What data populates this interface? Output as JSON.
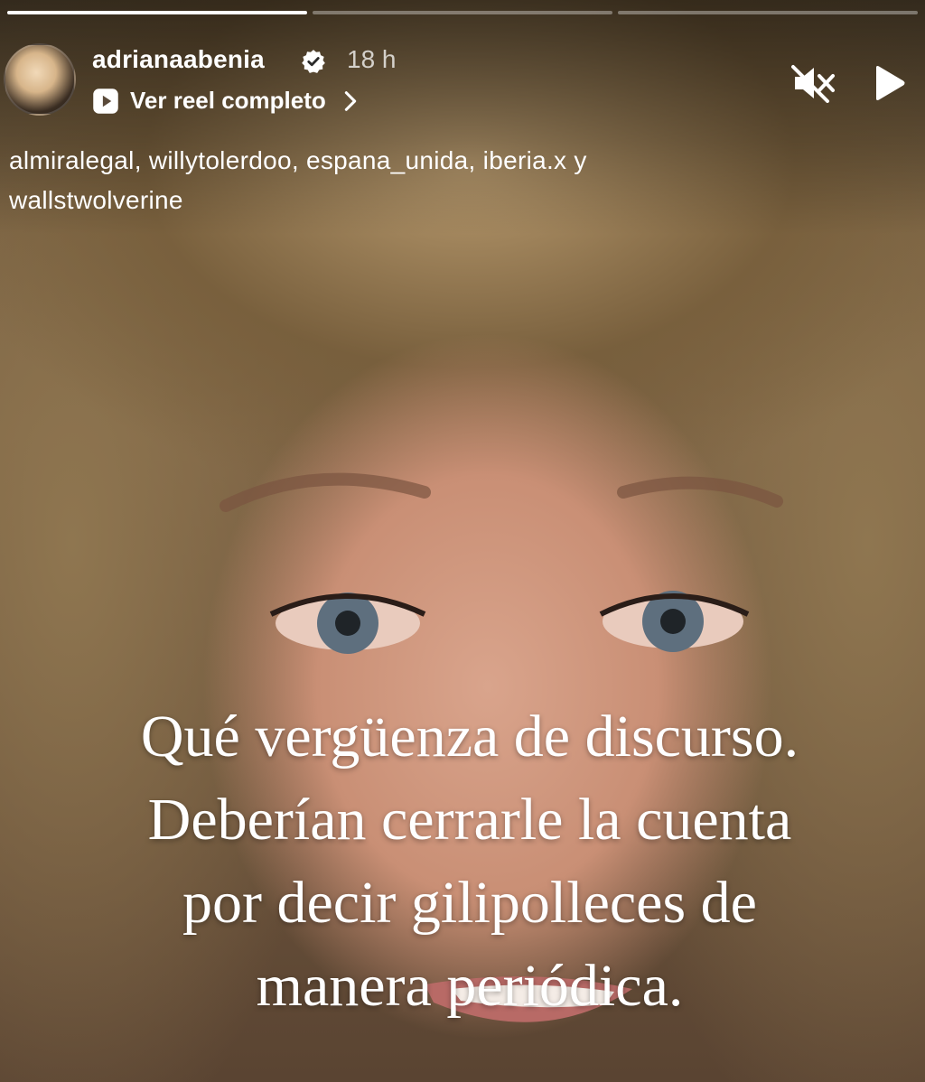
{
  "story": {
    "progress": [
      1,
      0,
      0
    ]
  },
  "header": {
    "username": "adrianaabenia",
    "time_ago": "18 h",
    "reel_link_label": "Ver reel completo"
  },
  "mentions": {
    "line1": "almiralegal, willytolerdoo, espana_unida, iberia.x y",
    "line2": "wallstwolverine"
  },
  "caption": {
    "line1": "Qué vergüenza de discurso.",
    "line2": "Deberían cerrarle la cuenta",
    "line3": "por decir gilipolleces de",
    "line4": "manera periódica."
  },
  "icons": {
    "verified": "verified-badge-icon",
    "reel": "reel-play-icon",
    "chevron": "chevron-right-icon",
    "mute": "muted-speaker-icon",
    "play": "play-icon"
  },
  "colors": {
    "text": "#ffffff",
    "progress_track": "rgba(255,255,255,0.35)"
  }
}
